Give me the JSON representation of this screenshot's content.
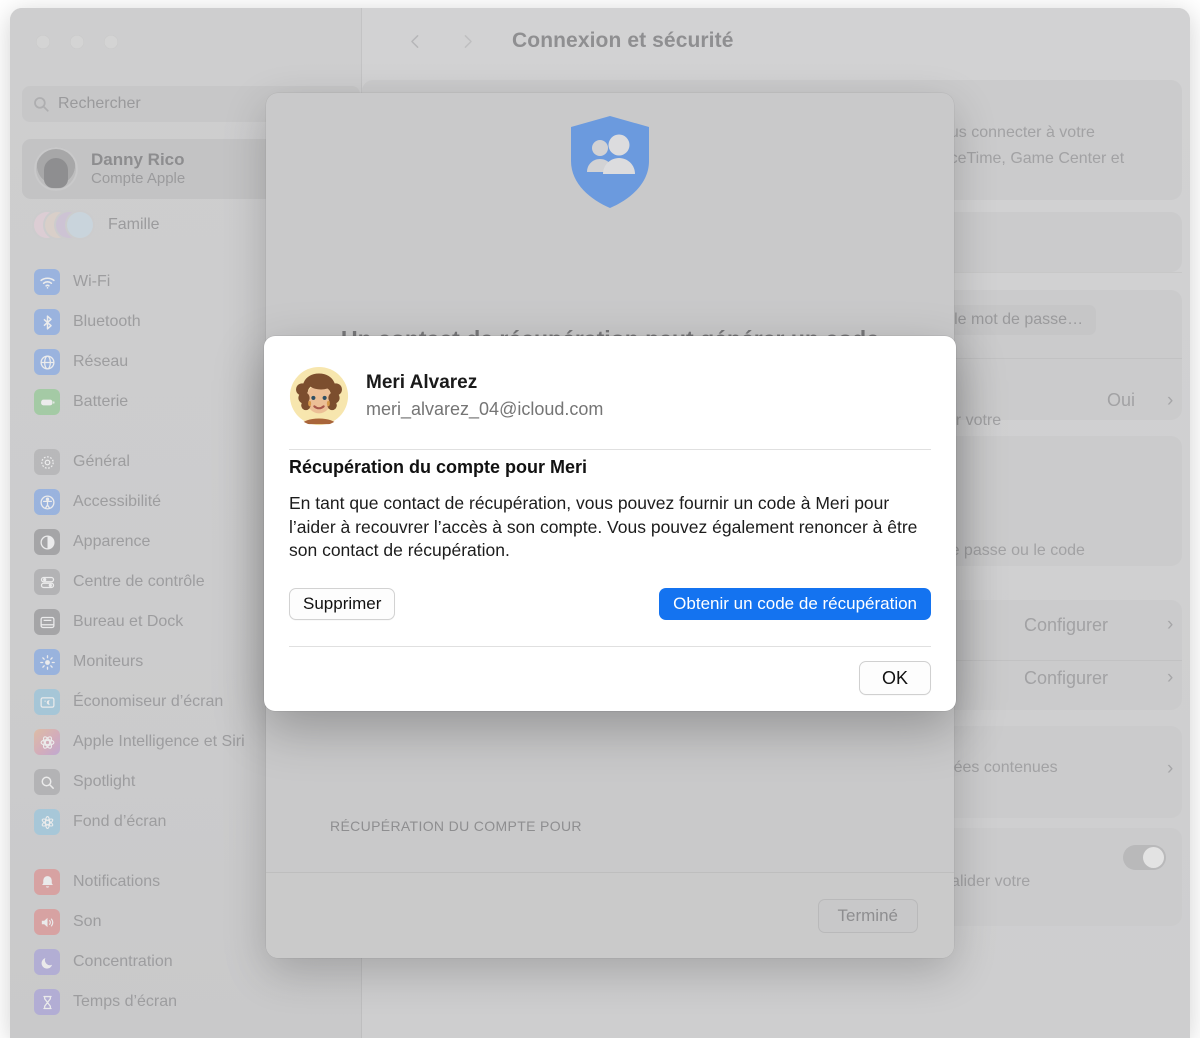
{
  "window": {
    "traffic_lights": [
      "close",
      "minimize",
      "zoom"
    ]
  },
  "sidebar": {
    "search": {
      "placeholder": "Rechercher",
      "icon": "search-icon"
    },
    "account": {
      "name": "Danny Rico",
      "subtitle": "Compte Apple",
      "avatar": "memoji-avatar"
    },
    "family": {
      "label": "Famille",
      "icon": "family-avatars"
    },
    "groups": [
      {
        "items": [
          {
            "label": "Wi-Fi",
            "icon": "wifi-icon",
            "color": "#7ba4e8"
          },
          {
            "label": "Bluetooth",
            "icon": "bluetooth-icon",
            "color": "#7ba4e8"
          },
          {
            "label": "Réseau",
            "icon": "globe-icon",
            "color": "#7ba4e8"
          },
          {
            "label": "Batterie",
            "icon": "battery-icon",
            "color": "#8bc98d"
          }
        ]
      },
      {
        "items": [
          {
            "label": "Général",
            "icon": "gear-icon",
            "color": "#adadaf"
          },
          {
            "label": "Accessibilité",
            "icon": "accessibility-icon",
            "color": "#7ba4e8"
          },
          {
            "label": "Apparence",
            "icon": "appearance-icon",
            "color": "#8e8e90"
          },
          {
            "label": "Centre de contrôle",
            "icon": "control-center-icon",
            "color": "#a5a5a7"
          },
          {
            "label": "Bureau et Dock",
            "icon": "desktop-dock-icon",
            "color": "#8e8e90"
          },
          {
            "label": "Moniteurs",
            "icon": "displays-icon",
            "color": "#7ba4e8"
          },
          {
            "label": "Économiseur d’écran",
            "icon": "screensaver-icon",
            "color": "#8fc3de"
          },
          {
            "label": "Apple Intelligence et Siri",
            "icon": "siri-icon",
            "color": "#d99bb0"
          },
          {
            "label": "Spotlight",
            "icon": "spotlight-icon",
            "color": "#a5a5a7"
          },
          {
            "label": "Fond d’écran",
            "icon": "wallpaper-icon",
            "color": "#92c6e0"
          }
        ]
      },
      {
        "items": [
          {
            "label": "Notifications",
            "icon": "notifications-icon",
            "color": "#e08a8a"
          },
          {
            "label": "Son",
            "icon": "sound-icon",
            "color": "#e08a8a"
          },
          {
            "label": "Concentration",
            "icon": "focus-icon",
            "color": "#a49ddb"
          },
          {
            "label": "Temps d’écran",
            "icon": "screen-time-icon",
            "color": "#a49ddb"
          }
        ]
      }
    ]
  },
  "toolbar": {
    "back_icon": "chevron-left-icon",
    "forward_icon": "chevron-right-icon",
    "title": "Connexion et sécurité"
  },
  "background_pane": {
    "fragments": [
      "vous connecter à votre",
      ", FaceTime, Game Center et",
      "difier le mot de passe…",
      "Oui",
      "alider votre",
      "not de passe ou le code",
      "Configurer",
      "Configurer",
      "données contenues",
      "loud à valider votre",
      "…"
    ]
  },
  "sheet": {
    "icon": "recovery-contact-shield-icon",
    "hero_title": "Un contact de récupération peut générer un code pour vous sur son appareil.",
    "section_label": "RÉCUPÉRATION DU COMPTE POUR",
    "contact": {
      "name": "Meri Alvarez",
      "avatar": "memoji-avatar",
      "chevron": "chevron-right-icon"
    },
    "done_label": "Terminé"
  },
  "modal": {
    "contact": {
      "name": "Meri Alvarez",
      "email": "meri_alvarez_04@icloud.com",
      "avatar": "memoji-avatar"
    },
    "heading": "Récupération du compte pour Meri",
    "body": "En tant que contact de récupération, vous pouvez fournir un code à Meri pour l’aider à recouvrer l’accès à son compte. Vous pouvez également renoncer à être son contact de récupération.",
    "delete_label": "Supprimer",
    "primary_label": "Obtenir un code de récupération",
    "ok_label": "OK"
  },
  "colors": {
    "accent_blue": "#1473f0",
    "shield_blue": "#6b9ade",
    "window_gray": "#cfcfcf",
    "modal_white": "#ffffff"
  }
}
